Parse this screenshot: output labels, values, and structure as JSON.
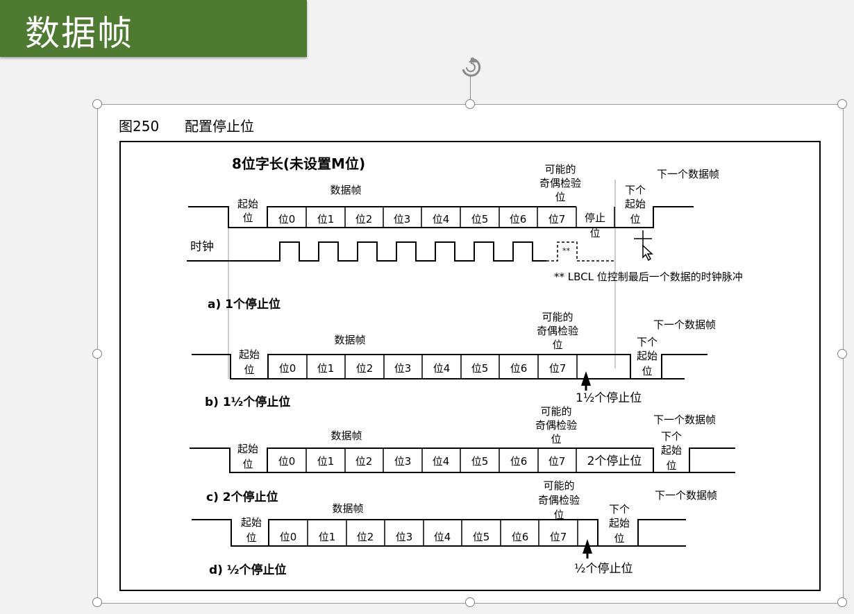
{
  "slide": {
    "title": "数据帧"
  },
  "figure": {
    "caption_num": "图250",
    "caption_title": "配置停止位",
    "heading": "8位字长(未设置M位)",
    "clock_label": "时钟",
    "lbcl_note": "** LBCL 位控制最后一个数据的时钟脉冲",
    "lbcl_stars": "**",
    "frame_label": "数据帧",
    "start_bit": [
      "起始",
      "位"
    ],
    "parity": [
      "可能的",
      "奇偶检验",
      "位"
    ],
    "next_start": [
      "下个",
      "起始",
      "位"
    ],
    "next_frame": "下一个数据帧",
    "bits": [
      "位0",
      "位1",
      "位2",
      "位3",
      "位4",
      "位5",
      "位6",
      "位7"
    ],
    "stop_bit_a": [
      "停止",
      "位"
    ],
    "case_a": "a) 1个停止位",
    "case_b": "b) 1½个停止位",
    "stop_b": "1½个停止位",
    "case_c": "c) 2个停止位",
    "stop_c": "2个停止位",
    "case_d": "d) ½个停止位",
    "stop_d": "½个停止位"
  },
  "colors": {
    "title_bar": "#4f7a32",
    "line": "#000000"
  }
}
